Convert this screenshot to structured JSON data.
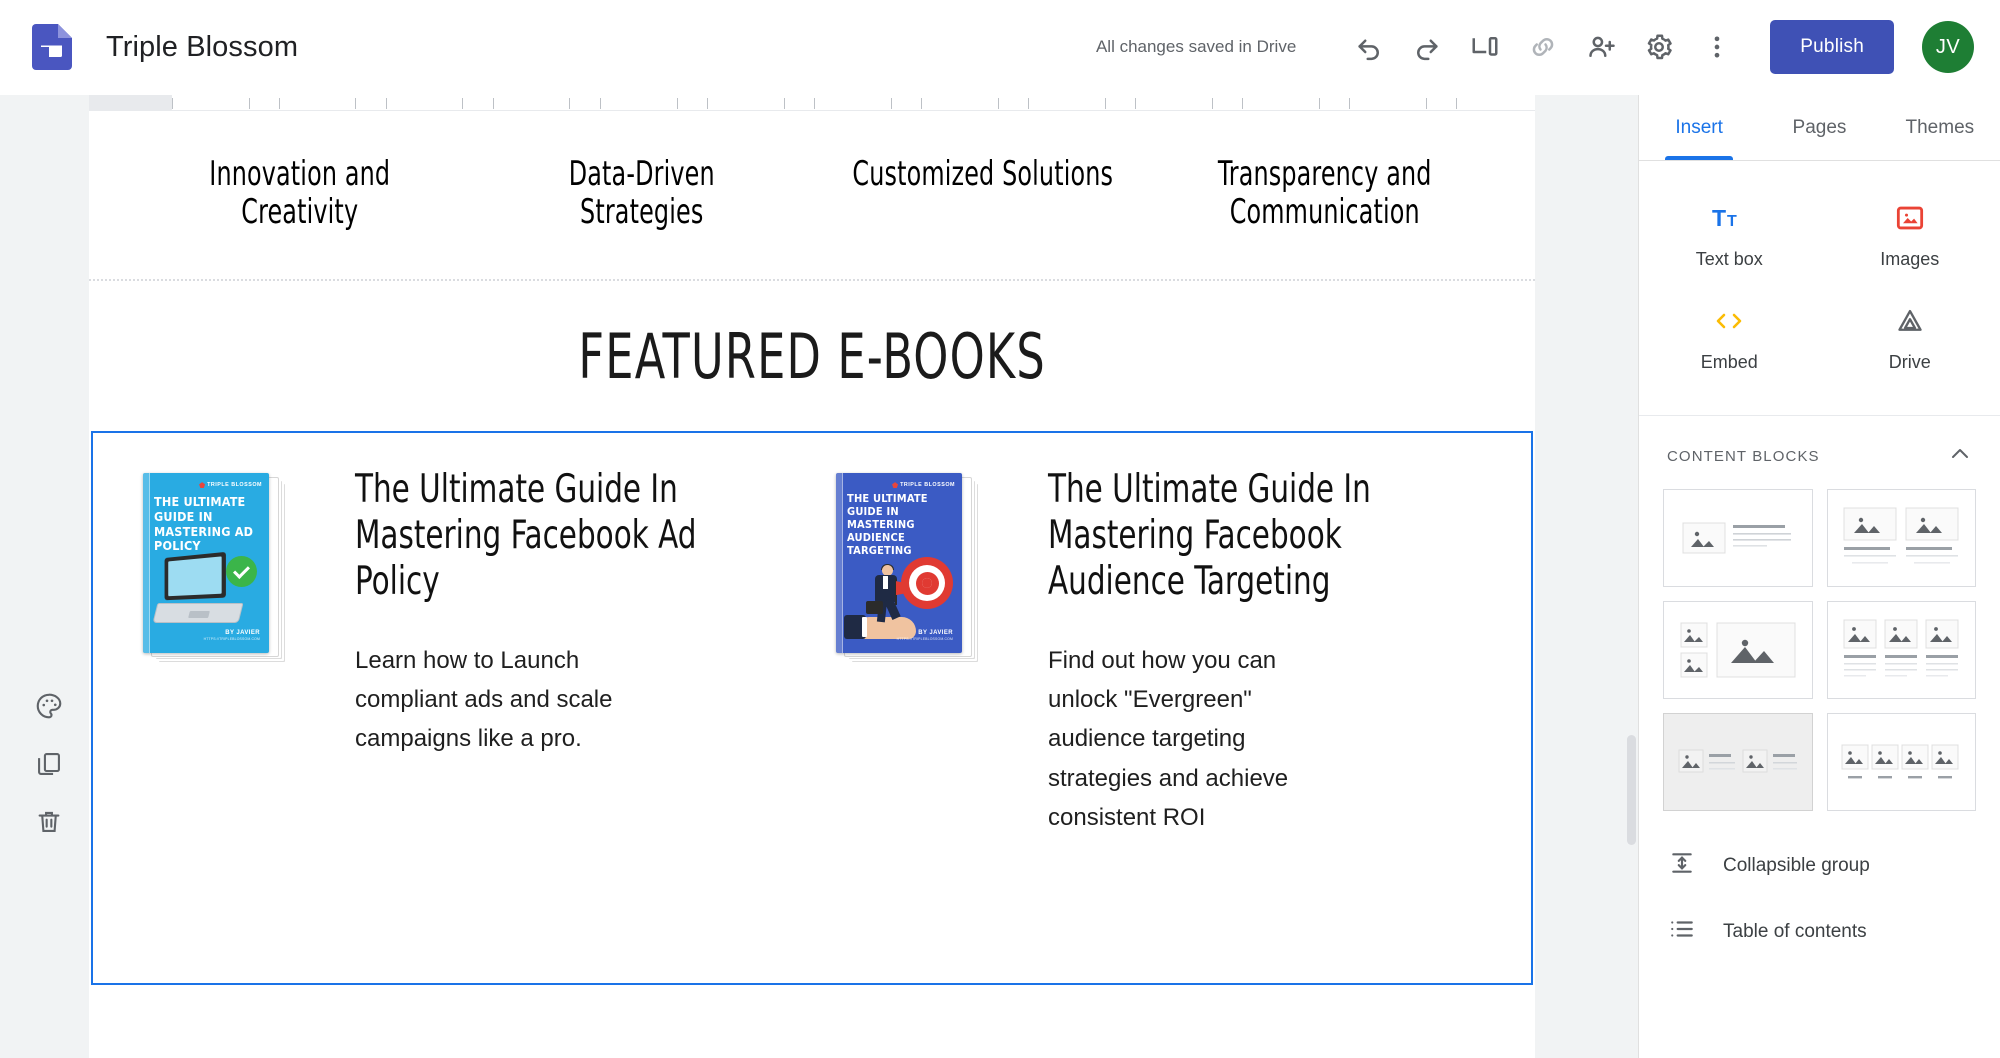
{
  "app": {
    "logo_icon": "google-sites-icon",
    "title": "Triple Blossom",
    "save_status": "All changes saved in Drive",
    "publish_label": "Publish",
    "avatar_initials": "JV",
    "accent_color": "#3f51b5",
    "avatar_color": "#1e7e34",
    "link_color": "#1a73e8"
  },
  "toolbar": {
    "buttons": [
      {
        "name": "undo-button",
        "icon": "undo-icon"
      },
      {
        "name": "redo-button",
        "icon": "redo-icon"
      },
      {
        "name": "preview-button",
        "icon": "preview-devices-icon"
      },
      {
        "name": "copy-link-button",
        "icon": "link-icon"
      },
      {
        "name": "share-button",
        "icon": "add-person-icon"
      },
      {
        "name": "settings-button",
        "icon": "gear-icon"
      },
      {
        "name": "more-options-button",
        "icon": "three-dot-menu-icon"
      }
    ]
  },
  "left_rail": {
    "buttons": [
      {
        "name": "section-background-button",
        "icon": "palette-icon"
      },
      {
        "name": "duplicate-section-button",
        "icon": "duplicate-icon"
      },
      {
        "name": "delete-section-button",
        "icon": "trash-icon"
      }
    ]
  },
  "canvas": {
    "value_props": [
      "Innovation and Creativity",
      "Data-Driven Strategies",
      "Customized Solutions",
      "Transparency and Communication"
    ],
    "featured_heading": "FEATURED E-BOOKS",
    "ebooks": [
      {
        "heading": "The Ultimate Guide In Mastering Facebook Ad Policy",
        "description": "Learn how to Launch compliant ads and scale campaigns like a pro.",
        "cover": {
          "brand": "TRIPLE BLOSSOM",
          "title": "THE ULTIMATE GUIDE IN MASTERING AD POLICY",
          "author": "BY JAVIER",
          "url": "HTTPS://TRIPLEBLOSSOM.COM",
          "background_color": "#29abe2",
          "art": "laptop-with-green-check"
        }
      },
      {
        "heading": "The Ultimate Guide In Mastering Facebook Audience Targeting",
        "description": "Find out how you can unlock \"Evergreen\" audience targeting strategies and achieve consistent ROI",
        "cover": {
          "brand": "TRIPLE BLOSSOM",
          "title": "THE ULTIMATE GUIDE IN MASTERING AUDIENCE TARGETING",
          "author": "BY JAVIER",
          "url": "HTTPS://TRIPLEBLOSSOM.COM",
          "background_color": "#3b5bc4",
          "art": "businessman-on-hand-with-target"
        }
      }
    ]
  },
  "right_panel": {
    "tabs": [
      {
        "label": "Insert",
        "active": true
      },
      {
        "label": "Pages",
        "active": false
      },
      {
        "label": "Themes",
        "active": false
      }
    ],
    "insert_items": [
      {
        "label": "Text box",
        "icon": "text-box-icon"
      },
      {
        "label": "Images",
        "icon": "images-icon"
      },
      {
        "label": "Embed",
        "icon": "embed-code-icon"
      },
      {
        "label": "Drive",
        "icon": "google-drive-icon"
      }
    ],
    "content_blocks": {
      "header": "CONTENT BLOCKS",
      "collapse_icon": "chevron-up-icon",
      "layouts": [
        {
          "name": "image-left-text-right",
          "highlighted": false
        },
        {
          "name": "two-images-with-captions",
          "highlighted": false
        },
        {
          "name": "two-small-images-one-large",
          "highlighted": false
        },
        {
          "name": "three-images-with-text",
          "highlighted": false
        },
        {
          "name": "two-image-text-pairs-inline",
          "highlighted": true
        },
        {
          "name": "four-images-with-labels",
          "highlighted": false
        }
      ]
    },
    "list_items": [
      {
        "label": "Collapsible group",
        "icon": "collapsible-group-icon"
      },
      {
        "label": "Table of contents",
        "icon": "table-of-contents-icon"
      }
    ]
  }
}
